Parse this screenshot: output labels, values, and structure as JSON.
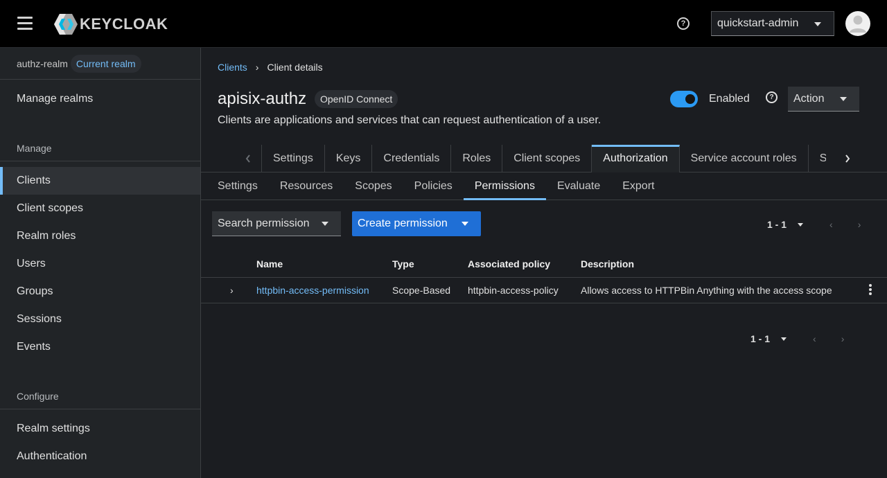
{
  "app": {
    "logo_text": "KEYCLOAK",
    "user_menu": "quickstart-admin",
    "icons": {
      "menu": "hamburger-icon",
      "help": "help-icon",
      "dropdown": "caret-down-icon",
      "avatar": "user-avatar-icon",
      "next": "chevron-right-icon",
      "previous": "chevron-left-icon",
      "kebab": "kebab-icon"
    }
  },
  "sidebar": {
    "realm_name": "authz-realm",
    "realm_badge": "Current realm",
    "manage_realms": "Manage realms",
    "manage_section": "Manage",
    "manage_items": [
      "Clients",
      "Client scopes",
      "Realm roles",
      "Users",
      "Groups",
      "Sessions",
      "Events"
    ],
    "active_item": "Clients",
    "configure_section": "Configure",
    "configure_items": [
      "Realm settings",
      "Authentication"
    ]
  },
  "breadcrumb": {
    "parent": "Clients",
    "current": "Client details"
  },
  "header": {
    "title": "apisix-authz",
    "protocol": "OpenID Connect",
    "description": "Clients are applications and services that can request authentication of a user.",
    "enabled_label": "Enabled",
    "enabled": true,
    "action_label": "Action"
  },
  "tabs": {
    "items": [
      "Settings",
      "Keys",
      "Credentials",
      "Roles",
      "Client scopes",
      "Authorization",
      "Service account roles",
      "Se"
    ],
    "active": "Authorization"
  },
  "subtabs": {
    "items": [
      "Settings",
      "Resources",
      "Scopes",
      "Policies",
      "Permissions",
      "Evaluate",
      "Export"
    ],
    "active": "Permissions"
  },
  "toolbar": {
    "search_label": "Search permission",
    "create_label": "Create permission",
    "pagination": "1 - 1"
  },
  "table": {
    "columns": [
      "Name",
      "Type",
      "Associated policy",
      "Description"
    ],
    "rows": [
      {
        "name": "httpbin-access-permission",
        "type": "Scope-Based",
        "policy": "httpbin-access-policy",
        "description": "Allows access to HTTPBin Anything with the access scope"
      }
    ]
  },
  "colors": {
    "accent": "#73bcf7",
    "primary_button": "#1f6fd6",
    "toggle_on": "#2b9af3",
    "background": "#1b1d21",
    "masthead": "#000000"
  }
}
